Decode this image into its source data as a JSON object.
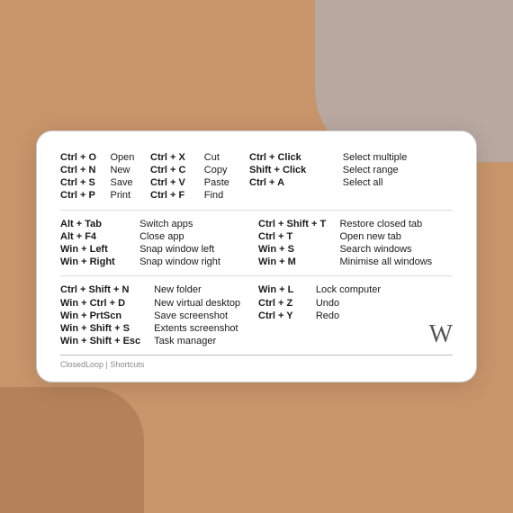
{
  "card": {
    "footer": "ClosedLoop | Shortcuts",
    "logo": "W"
  },
  "sections": {
    "basic": [
      {
        "key": "Ctrl + O",
        "action": "Open"
      },
      {
        "key": "Ctrl + N",
        "action": "New"
      },
      {
        "key": "Ctrl + S",
        "action": "Save"
      },
      {
        "key": "Ctrl + P",
        "action": "Print"
      }
    ],
    "clipboard": [
      {
        "key": "Ctrl + X",
        "action": "Cut"
      },
      {
        "key": "Ctrl + C",
        "action": "Copy"
      },
      {
        "key": "Ctrl + V",
        "action": "Paste"
      },
      {
        "key": "Ctrl + F",
        "action": "Find"
      }
    ],
    "mouse": [
      {
        "key": "Ctrl + Click",
        "action": "Select multiple"
      },
      {
        "key": "Shift + Click",
        "action": "Select range"
      },
      {
        "key": "Ctrl + A",
        "action": "Select all"
      }
    ],
    "window": [
      {
        "key": "Alt + Tab",
        "action": "Switch apps"
      },
      {
        "key": "Alt + F4",
        "action": "Close app"
      },
      {
        "key": "Win + Left",
        "action": "Snap window left"
      },
      {
        "key": "Win + Right",
        "action": "Snap window right"
      }
    ],
    "browser": [
      {
        "key": "Ctrl + Shift + T",
        "action": "Restore closed tab"
      },
      {
        "key": "Ctrl + T",
        "action": "Open new tab"
      },
      {
        "key": "Win + S",
        "action": "Search windows"
      },
      {
        "key": "Win + M",
        "action": "Minimise all windows"
      }
    ],
    "misc": [
      {
        "key": "Ctrl + Shift + N",
        "action": "New folder"
      },
      {
        "key": "Win + Ctrl + D",
        "action": "New virtual desktop"
      },
      {
        "key": "Win + PrtScn",
        "action": "Save screenshot"
      },
      {
        "key": "Win + Shift + S",
        "action": "Extents screenshot"
      },
      {
        "key": "Win + Shift + Esc",
        "action": "Task manager"
      }
    ],
    "misc2": [
      {
        "key": "Win + L",
        "action": "Lock computer"
      },
      {
        "key": "Ctrl + Z",
        "action": "Undo"
      },
      {
        "key": "Ctrl + Y",
        "action": "Redo"
      }
    ]
  }
}
